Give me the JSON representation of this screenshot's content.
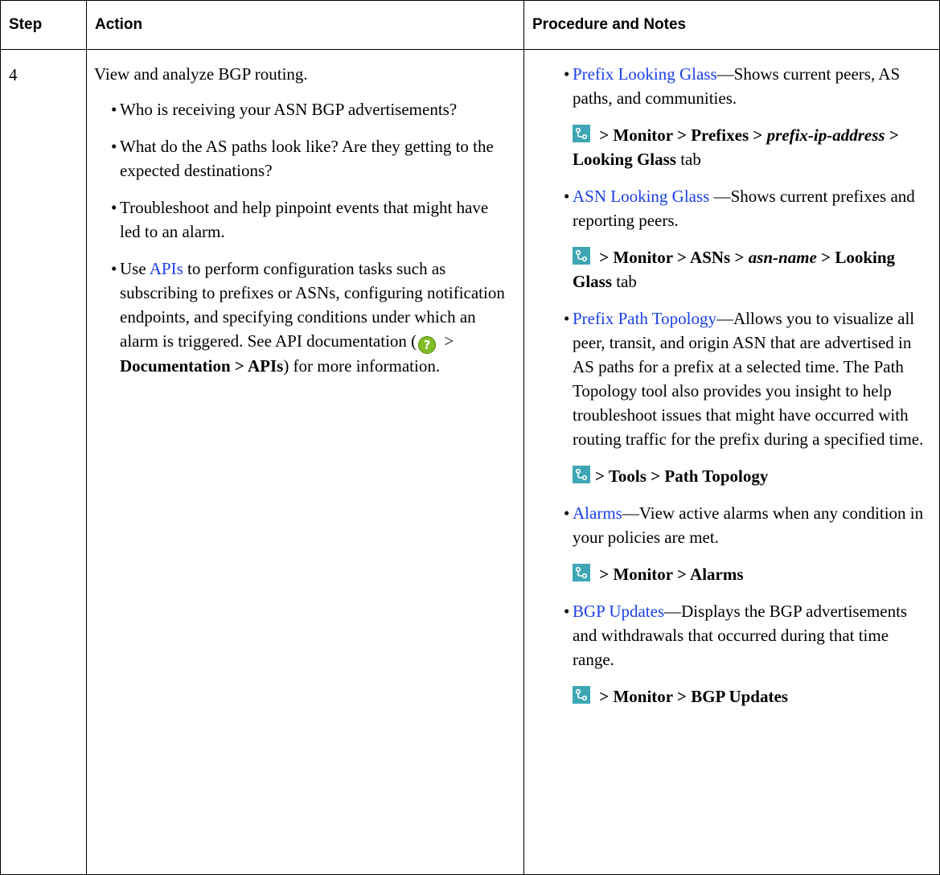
{
  "table": {
    "headers": {
      "step": "Step",
      "action": "Action",
      "procedure": "Procedure and Notes"
    },
    "row": {
      "step": "4",
      "action": {
        "intro": "View and analyze BGP routing.",
        "bullets": [
          "Who is receiving your ASN BGP advertisements?",
          "What do the AS paths look like? Are they getting to the expected destinations?",
          "Troubleshoot and help pinpoint events that might have led to an alarm."
        ],
        "api_bullet": {
          "pre": "Use ",
          "link": "APIs",
          "mid": " to perform configuration tasks such as subscribing to prefixes or ASNs, configuring notification endpoints, and specifying conditions under which an alarm is triggered. See API documentation (",
          "after_icon": " > ",
          "bold": "Documentation > APIs",
          "post": ") for more information."
        }
      },
      "procedure": [
        {
          "link": "Prefix Looking Glass",
          "text": "—Shows current peers, AS paths, and communities.",
          "nav": {
            "a": " > Monitor > Prefixes > ",
            "italic": "prefix-ip-address",
            "b": " > Looking Glass",
            "tail": " tab"
          }
        },
        {
          "link": "ASN Looking Glass",
          "text": " —Shows current prefixes and reporting peers.",
          "nav": {
            "a": " > Monitor > ASNs > ",
            "italic": "asn-name",
            "b": " > Looking Glass",
            "tail": " tab"
          }
        },
        {
          "link": "Prefix Path Topology",
          "text": "—Allows you to visualize all peer, transit, and origin ASN that are advertised in AS paths for a prefix at a selected time. The Path Topology tool also provides you insight to help troubleshoot issues that might have occurred with routing traffic for the prefix during a specified time.",
          "nav": {
            "a": "> Tools > Path Topology"
          }
        },
        {
          "link": "Alarms",
          "text": "—View active alarms when any condition in your policies are met.",
          "nav": {
            "a": " > Monitor > Alarms"
          }
        },
        {
          "link": "BGP Updates",
          "text": "—Displays the BGP advertisements and withdrawals that occurred during that time range.",
          "nav": {
            "a": " > Monitor > BGP Updates"
          }
        }
      ]
    },
    "icons": {
      "topology": "topology-icon",
      "help": "help-icon",
      "help_glyph": "?"
    },
    "colors": {
      "link": "#1b40e8",
      "topology_icon_bg": "#3ea6b5",
      "help_icon_bg": "#80bd26"
    }
  }
}
